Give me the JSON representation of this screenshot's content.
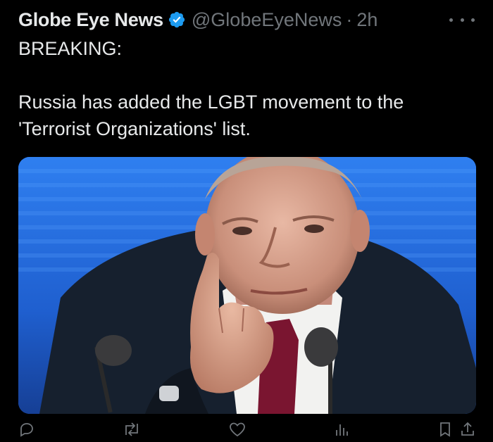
{
  "tweet": {
    "display_name": "Globe Eye News",
    "handle": "@GlobeEyeNews",
    "separator": "·",
    "time": "2h",
    "text_line1": "BREAKING:",
    "text_line2": "Russia has added the LGBT movement to the 'Terrorist Organizations' list.",
    "verified_color": "#1d9bf0",
    "media_icon": "photo-of-man-at-microphone"
  },
  "actions": {
    "reply_icon": "reply-icon",
    "retweet_icon": "retweet-icon",
    "like_icon": "heart-icon",
    "views_icon": "views-icon",
    "bookmark_icon": "bookmark-icon",
    "share_icon": "share-icon"
  },
  "colors": {
    "background": "#000000",
    "text": "#e7e9ea",
    "muted": "#71767b"
  }
}
